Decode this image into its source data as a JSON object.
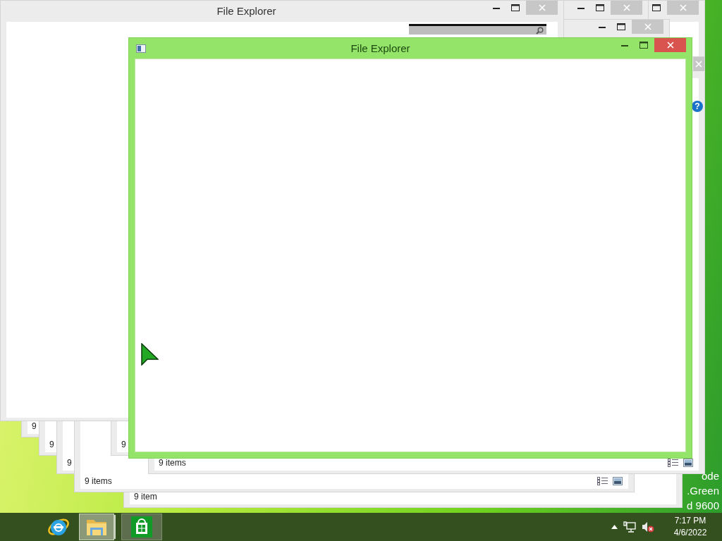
{
  "windows": [
    {
      "status": "9 item"
    },
    {
      "status": "9"
    },
    {
      "status": "9"
    },
    {
      "status": "9"
    },
    {
      "status": "9 items"
    },
    {
      "status": "9"
    },
    {
      "status": "9 items",
      "help": "?"
    },
    {
      "title": "File Explorer"
    }
  ],
  "active_window": {
    "title": "File Explorer"
  },
  "desktop_text": [
    "ode",
    ".Green",
    "d 9600"
  ],
  "taskbar": {
    "apps": [
      {
        "kind": "browser",
        "selected": false
      },
      {
        "kind": "folder",
        "selected": true
      },
      {
        "kind": "store",
        "selected": false
      }
    ],
    "tray": {
      "sound_muted": true,
      "time": "7:17 PM",
      "date": "4/6/2022"
    }
  }
}
